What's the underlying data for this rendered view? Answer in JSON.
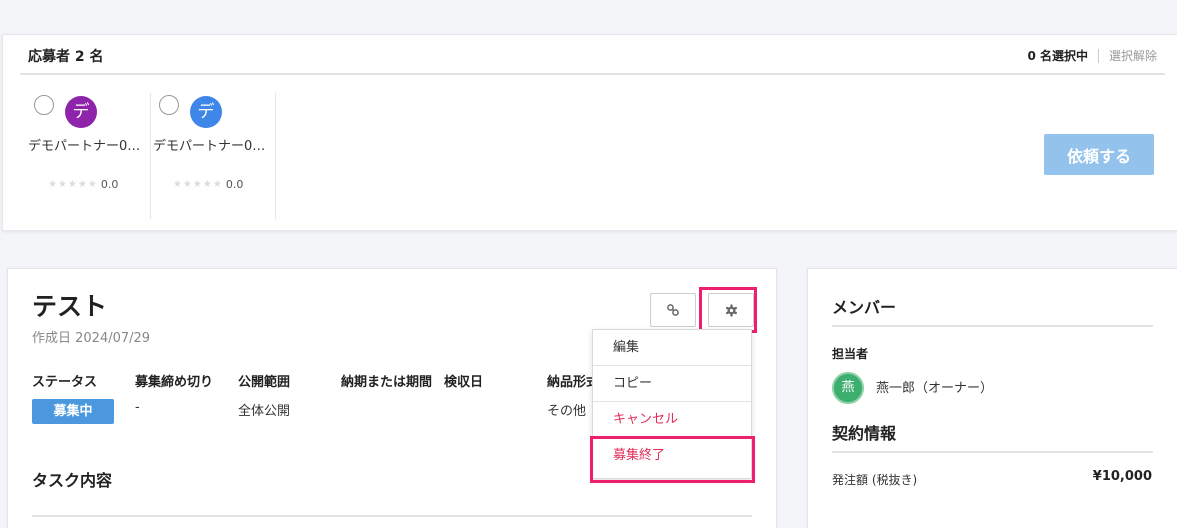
{
  "applicants": {
    "title": "応募者 2 名",
    "selected_count": "0 名選択中",
    "deselect": "選択解除",
    "partners": [
      {
        "avatar_char": "デ",
        "avatar_color": "#8e24aa",
        "name": "デモパートナー0…",
        "stars": "★★★★★",
        "score": "0.0"
      },
      {
        "avatar_char": "デ",
        "avatar_color": "#3f86e9",
        "name": "デモパートナー0…",
        "stars": "★★★★★",
        "score": "0.0"
      }
    ],
    "request_button": "依頼する"
  },
  "task": {
    "title": "テスト",
    "created": "作成日 2024/07/29",
    "fields": [
      {
        "label": "ステータス",
        "value": "募集中"
      },
      {
        "label": "募集締め切り",
        "value": "-"
      },
      {
        "label": "公開範囲",
        "value": "全体公開"
      },
      {
        "label": "納期または期間",
        "value": ""
      },
      {
        "label": "検収日",
        "value": ""
      },
      {
        "label": "納品形式",
        "value": "その他"
      }
    ],
    "section_title": "タスク内容"
  },
  "dropdown": {
    "items": [
      "編集",
      "コピー",
      "キャンセル",
      "募集終了"
    ]
  },
  "members": {
    "title": "メンバー",
    "owner_label": "担当者",
    "owner_avatar": "燕",
    "owner_name": "燕一郎（オーナー）",
    "contract_title": "契約情報",
    "fee_label": "発注額 (税抜き)",
    "fee_value": "¥10,000"
  },
  "colors": {
    "accent": "#4b98df",
    "highlight": "#ee1f6e",
    "danger": "#e22d5a"
  }
}
